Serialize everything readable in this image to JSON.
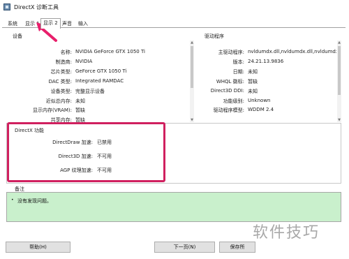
{
  "window": {
    "title": "DirectX 诊断工具"
  },
  "tabs": [
    {
      "label": "系统"
    },
    {
      "label": "显示 1"
    },
    {
      "label": "显示 2"
    },
    {
      "label": "声音"
    },
    {
      "label": "输入"
    }
  ],
  "device": {
    "section_label": "设备",
    "rows": [
      {
        "label": "名称:",
        "value": "NVIDIA GeForce GTX 1050 Ti"
      },
      {
        "label": "制造商:",
        "value": "NVIDIA"
      },
      {
        "label": "芯片类型:",
        "value": "GeForce GTX 1050 Ti"
      },
      {
        "label": "DAC 类型:",
        "value": "Integrated RAMDAC"
      },
      {
        "label": "设备类型:",
        "value": "完整显示设备"
      },
      {
        "label": "近似总内存:",
        "value": "未知"
      },
      {
        "label": "显示内存(VRAM):",
        "value": "暂缺"
      },
      {
        "label": "共享内存:",
        "value": "暂缺"
      }
    ]
  },
  "driver": {
    "section_label": "驱动程序",
    "rows": [
      {
        "label": "主驱动程序:",
        "value": "nvldumdx.dll,nvldumdx.dll,nvldumdx.dll,nvldumdx.dll"
      },
      {
        "label": "版本:",
        "value": "24.21.13.9836"
      },
      {
        "label": "日期:",
        "value": "未知"
      },
      {
        "label": "WHQL 徽标:",
        "value": "暂缺"
      },
      {
        "label": "Direct3D DDI:",
        "value": "未知"
      },
      {
        "label": "功能级别:",
        "value": "Unknown"
      },
      {
        "label": "驱动程序模型:",
        "value": "WDDM 2.4"
      }
    ]
  },
  "features": {
    "section_label": "DirectX 功能",
    "rows": [
      {
        "label": "DirectDraw 加速:",
        "value": "已禁用"
      },
      {
        "label": "Direct3D 加速:",
        "value": "不可用"
      },
      {
        "label": "AGP 纹理加速:",
        "value": "不可用"
      }
    ]
  },
  "notes": {
    "section_label": "备注",
    "bullet": "•",
    "text": "没有发现问题。"
  },
  "buttons": {
    "help": "帮助(H)",
    "next": "下一页(N)",
    "save": "保存所"
  },
  "watermark": {
    "text": "软件技巧"
  },
  "colors": {
    "highlight_border": "#d0205f",
    "notes_bg": "#c9f0cc"
  }
}
